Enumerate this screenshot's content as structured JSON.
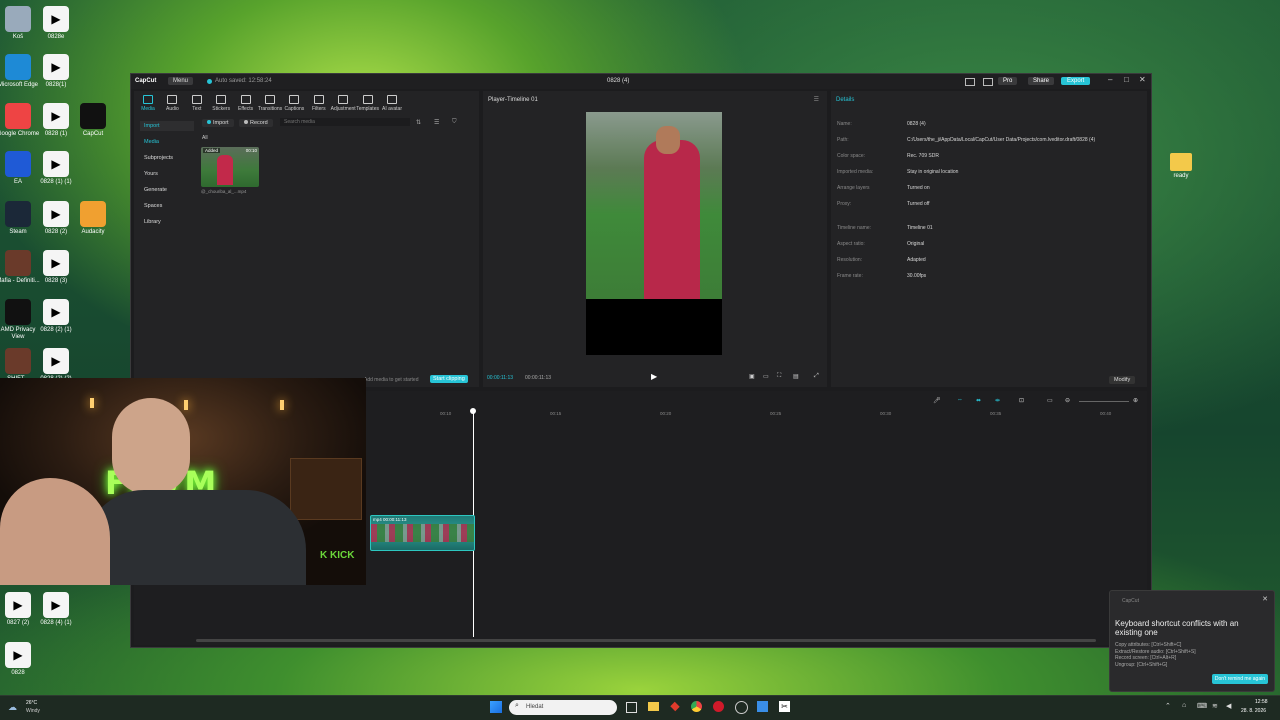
{
  "desktop": {
    "icons_left": [
      {
        "label": "Koš",
        "icon": "recycle-bin-icon"
      },
      {
        "label": "0828e",
        "icon": "video-file-icon"
      },
      {
        "label": "Microsoft Edge",
        "icon": "edge-icon"
      },
      {
        "label": "0828(1)",
        "icon": "video-file-icon"
      },
      {
        "label": "Google Chrome",
        "icon": "chrome-icon"
      },
      {
        "label": "0828 (1)",
        "icon": "video-file-icon"
      },
      {
        "label": "CapCut",
        "icon": "capcut-icon"
      },
      {
        "label": "EA",
        "icon": "ea-icon"
      },
      {
        "label": "0828 (1) (1)",
        "icon": "video-file-icon"
      },
      {
        "label": "Steam",
        "icon": "steam-icon"
      },
      {
        "label": "0828 (2)",
        "icon": "video-file-icon"
      },
      {
        "label": "Audacity",
        "icon": "audacity-icon"
      },
      {
        "label": "Mafia - Definiti...",
        "icon": "game-icon"
      },
      {
        "label": "0828 (3)",
        "icon": "video-file-icon"
      },
      {
        "label": "AMD Privacy View",
        "icon": "amd-icon"
      },
      {
        "label": "0828 (2) (1)",
        "icon": "video-file-icon"
      },
      {
        "label": "SHIFT...",
        "icon": "game-icon"
      },
      {
        "label": "0828 (2) (2)",
        "icon": "video-file-icon"
      },
      {
        "label": "0827 (2)",
        "icon": "video-file-icon"
      },
      {
        "label": "0828 (4) (1)",
        "icon": "video-file-icon"
      },
      {
        "label": "0828",
        "icon": "video-file-icon"
      }
    ],
    "icon_ready": {
      "label": "ready",
      "icon": "folder-icon"
    }
  },
  "app": {
    "logo": "CapCut",
    "menu_label": "Menu",
    "autosave": "Auto saved: 12:58:24",
    "title": "0828 (4)",
    "pro_label": "Pro",
    "share_label": "Share",
    "export_label": "Export",
    "toolbar": [
      "Media",
      "Audio",
      "Text",
      "Stickers",
      "Effects",
      "Transitions",
      "Captions",
      "Filters",
      "Adjustment",
      "Templates",
      "AI avatar"
    ],
    "nav": {
      "import": "Import",
      "media": "Media",
      "subprojects": "Subprojects",
      "yours": "Yours",
      "generate": "Generate",
      "spaces": "Spaces",
      "library": "Library"
    },
    "media": {
      "import_btn": "Import",
      "record_btn": "Record",
      "search_placeholder": "Search media",
      "filter_all": "All",
      "clip_badge": "Added",
      "clip_duration": "00:10",
      "clip_name": "@_chouriba_al_...mp4",
      "hint": "Add media to get started",
      "start_clipping": "Start clipping"
    },
    "player": {
      "title": "Player-Timeline 01",
      "current_time": "00:00:11:13",
      "total_time": "00:00:11:13"
    },
    "details": {
      "title": "Details",
      "rows": [
        {
          "k": "Name:",
          "v": "0828 (4)"
        },
        {
          "k": "Path:",
          "v": "C:/Users/the_ji/AppData/Local/CapCut/User Data/Projects/com.lveditor.draft/0828 (4)"
        },
        {
          "k": "Color space:",
          "v": "Rec. 709 SDR"
        },
        {
          "k": "Imported media:",
          "v": "Stay in original location"
        },
        {
          "k": "Arrange layers",
          "v": "Turned on"
        },
        {
          "k": "Proxy:",
          "v": "Turned off"
        },
        {
          "k": "Timeline name:",
          "v": "Timeline 01"
        },
        {
          "k": "Aspect ratio:",
          "v": "Original"
        },
        {
          "k": "Resolution:",
          "v": "Adapted"
        },
        {
          "k": "Frame rate:",
          "v": "30.00fps"
        }
      ],
      "modify_label": "Modify"
    },
    "timeline": {
      "ticks": [
        "00:10",
        "00:15",
        "00:20",
        "00:25",
        "00:30",
        "00:35",
        "00:40"
      ],
      "clip_label": "mp4  00:00:11:13"
    }
  },
  "webcam": {
    "neon_text": "FNVM",
    "kick_label": "K KICK"
  },
  "toast": {
    "app": "CapCut",
    "title": "Keyboard shortcut conflicts with an existing one",
    "lines": [
      "Copy attributes: [Ctrl+Shift+C]",
      "Extract/Restore audio: [Ctrl+Shift+S]",
      "Record screen: [Ctrl+Alt+R]",
      "Ungroup: [Ctrl+Shift+G]"
    ],
    "button": "Don't remind me again"
  },
  "taskbar": {
    "weather_temp": "26°C",
    "weather_desc": "Windy",
    "search_placeholder": "Hledat",
    "time": "12:58",
    "date": "28. 8. 2026"
  },
  "colors": {
    "accent": "#27c4d6",
    "panel": "#232325",
    "window": "#1c1c1e"
  }
}
